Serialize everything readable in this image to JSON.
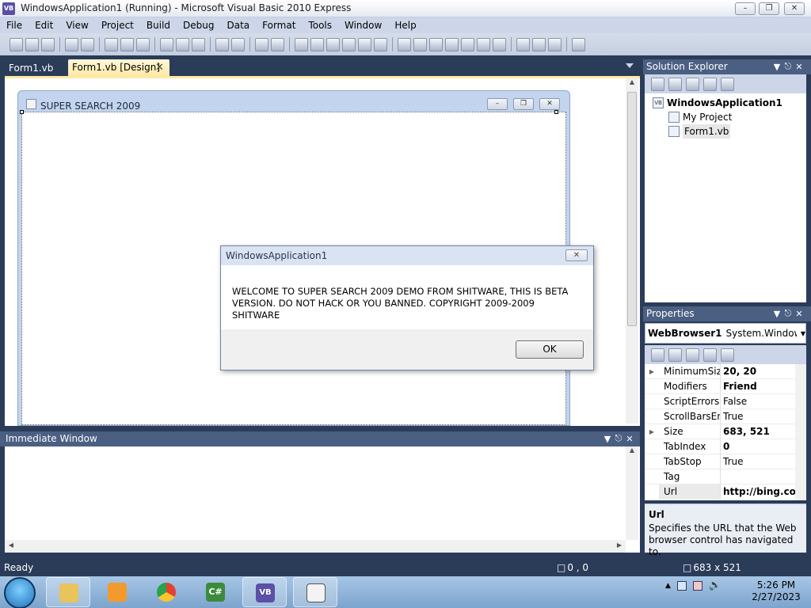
{
  "window": {
    "title": "WindowsApplication1 (Running) - Microsoft Visual Basic 2010 Express",
    "app_icon_label": "VB"
  },
  "menu": [
    "File",
    "Edit",
    "View",
    "Project",
    "Build",
    "Debug",
    "Data",
    "Format",
    "Tools",
    "Window",
    "Help"
  ],
  "doc_tabs": [
    {
      "label": "Form1.vb",
      "active": false
    },
    {
      "label": "Form1.vb [Design]",
      "active": true
    }
  ],
  "designer": {
    "form_title": "SUPER SEARCH 2009"
  },
  "message_box": {
    "title": "WindowsApplication1",
    "message": "WELCOME TO SUPER SEARCH 2009 DEMO FROM SHITWARE, THIS IS BETA VERSION. DO NOT HACK OR YOU BANNED. COPYRIGHT 2009-2009 SHITWARE",
    "ok_label": "OK"
  },
  "immediate_window": {
    "title": "Immediate Window"
  },
  "solution_explorer": {
    "title": "Solution Explorer",
    "tree": [
      {
        "label": "WindowsApplication1",
        "bold": true
      },
      {
        "label": "My Project"
      },
      {
        "label": "Form1.vb"
      }
    ]
  },
  "properties": {
    "title": "Properties",
    "object_name": "WebBrowser1",
    "object_type": "System.Windows.F",
    "rows": [
      {
        "name": "MinimumSize",
        "value": "20, 20",
        "bold": true,
        "expandable": true
      },
      {
        "name": "Modifiers",
        "value": "Friend",
        "bold": true
      },
      {
        "name": "ScriptErrorsSu",
        "value": "False"
      },
      {
        "name": "ScrollBarsEna",
        "value": "True"
      },
      {
        "name": "Size",
        "value": "683, 521",
        "bold": true,
        "expandable": true
      },
      {
        "name": "TabIndex",
        "value": "0",
        "bold": true
      },
      {
        "name": "TabStop",
        "value": "True"
      },
      {
        "name": "Tag",
        "value": ""
      },
      {
        "name": "Url",
        "value": "http://bing.com",
        "bold": true,
        "selected": true
      }
    ],
    "description_title": "Url",
    "description_text": "Specifies the URL that the Web browser control has navigated to."
  },
  "status": {
    "text": "Ready",
    "position": "0 , 0",
    "size": "683 x 521"
  },
  "taskbar": {
    "csharp_label": "C#",
    "vb_label": "VB",
    "clock_time": "5:26 PM",
    "clock_date": "2/27/2023"
  }
}
